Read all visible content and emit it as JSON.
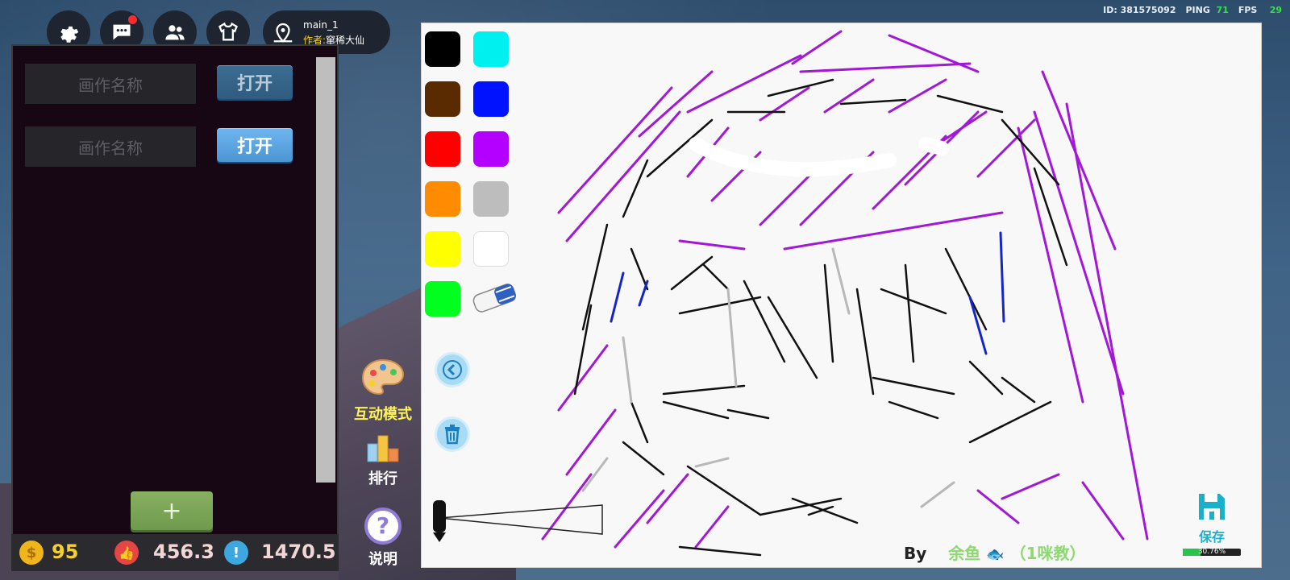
{
  "hud": {
    "icons": [
      "gear-icon",
      "chat-icon",
      "friends-icon",
      "outfit-icon"
    ],
    "map_name": "main_1",
    "author_label": "作者:",
    "author_name": "窜稀大仙",
    "id_text": "ID: 381575092",
    "ping_label": "PING",
    "ping_value": "71",
    "fps_label": "FPS",
    "fps_value": "29"
  },
  "panel": {
    "rows": [
      {
        "name_placeholder": "画作名称",
        "open_label": "打开",
        "state": "dim"
      },
      {
        "name_placeholder": "画作名称",
        "open_label": "打开",
        "state": "lit"
      }
    ],
    "add_label": "+"
  },
  "currency": {
    "coins": "95",
    "likes": "456.3",
    "points": "1470.5"
  },
  "side": {
    "interact_label": "互动模式",
    "rank_label": "排行",
    "help_label": "说明"
  },
  "palette": {
    "colors": [
      "#000000",
      "#00f0f0",
      "#5a2a00",
      "#0012ff",
      "#ff0000",
      "#b400ff",
      "#ff8c00",
      "#bdbdbd",
      "#ffff00",
      "#ffffff",
      "#00ff1e"
    ],
    "eraser": "eraser-icon"
  },
  "canvas": {
    "by_label": "By",
    "artist_name": "余鱼",
    "artist_suffix": "（1咪教）",
    "save_label": "保存",
    "progress_text": "30.76%",
    "progress_fraction": 0.3076
  }
}
